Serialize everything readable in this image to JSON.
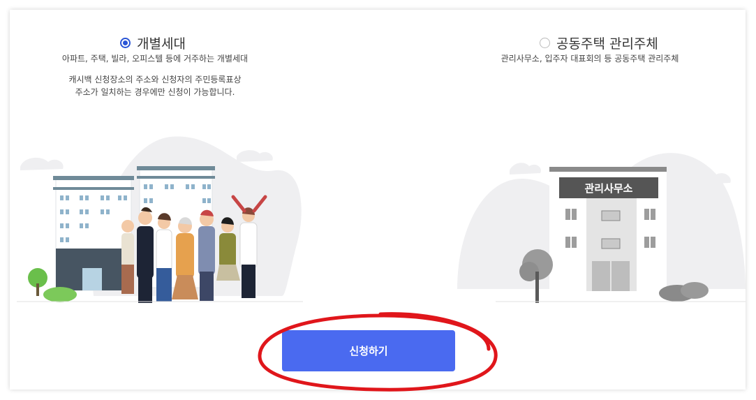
{
  "options": [
    {
      "label": "개별세대",
      "selected": true,
      "description": "아파트, 주택, 빌라, 오피스텔 등에 거주하는 개별세대",
      "notice_line1": "캐시백 신청장소의 주소와 신청자의 주민등록표상",
      "notice_line2": "주소가 일치하는 경우에만 신청이 가능합니다."
    },
    {
      "label": "공동주택 관리주체",
      "selected": false,
      "description": "관리사무소, 입주자 대표회의 등 공동주택 관리주체",
      "building_sign": "관리사무소"
    }
  ],
  "apply_button": {
    "label": "신청하기"
  },
  "colors": {
    "accent": "#4a6af0",
    "radio_selected": "#2a55d6",
    "annotation": "#e0161b"
  }
}
